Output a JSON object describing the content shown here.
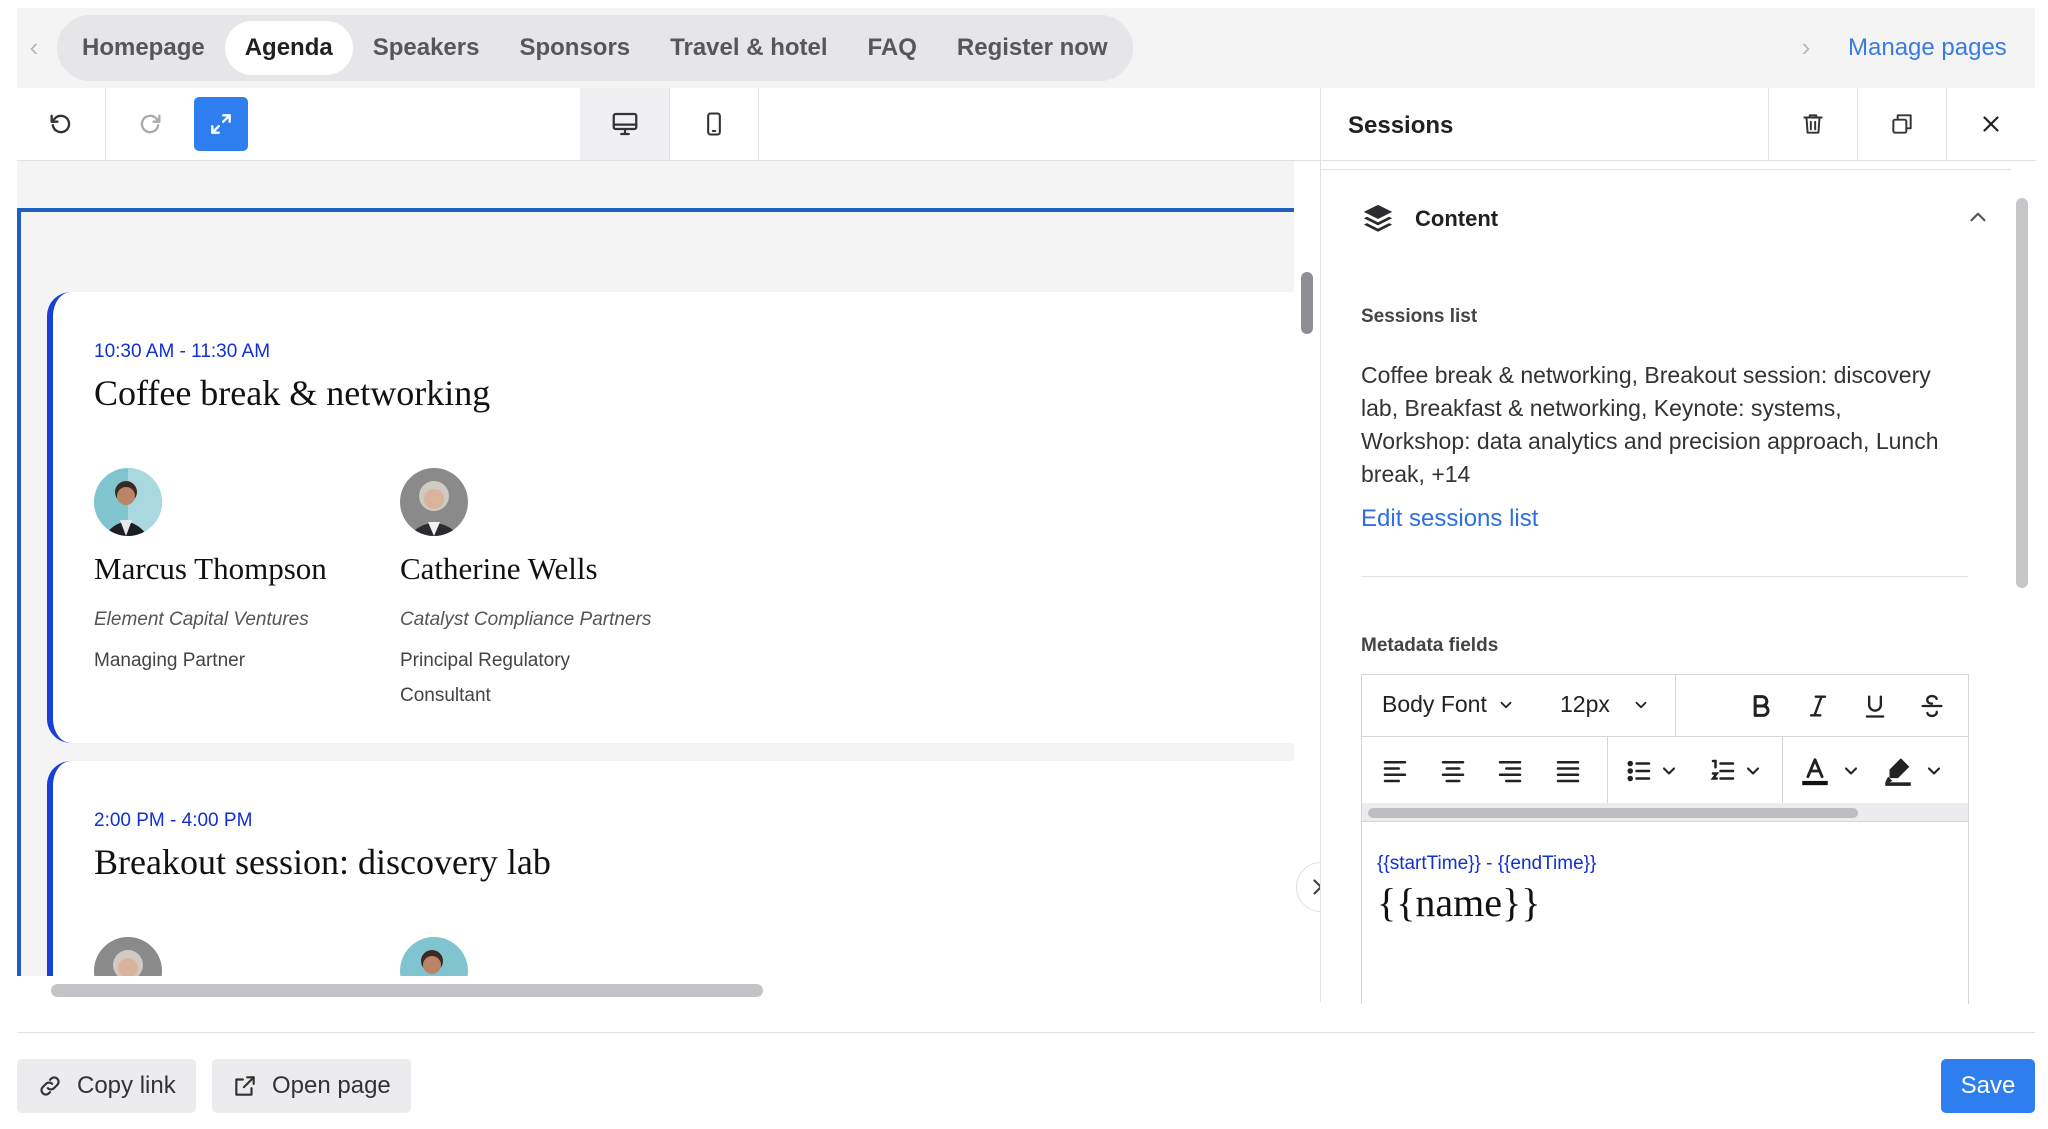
{
  "nav": {
    "pages": [
      {
        "label": "Homepage"
      },
      {
        "label": "Agenda",
        "active": true
      },
      {
        "label": "Speakers"
      },
      {
        "label": "Sponsors"
      },
      {
        "label": "Travel & hotel"
      },
      {
        "label": "FAQ"
      },
      {
        "label": "Register now"
      }
    ],
    "manage_pages": "Manage pages"
  },
  "toolbar": {
    "icons": [
      "undo-icon",
      "redo-icon",
      "expand-icon",
      "desktop-icon",
      "mobile-icon"
    ]
  },
  "preview": {
    "sessions": [
      {
        "time": "10:30 AM - 11:30 AM",
        "title": "Coffee break & networking",
        "speakers": [
          {
            "name": "Marcus Thompson",
            "company": "Element Capital Ventures",
            "role": "Managing Partner"
          },
          {
            "name": "Catherine Wells",
            "company": "Catalyst Compliance Partners",
            "role": "Principal Regulatory Consultant"
          }
        ]
      },
      {
        "time": "2:00 PM - 4:00 PM",
        "title": "Breakout session: discovery lab"
      }
    ]
  },
  "panel": {
    "title": "Sessions",
    "section_title": "Content",
    "sessions_list_label": "Sessions list",
    "sessions_list_value": "Coffee break & networking, Breakout session: discovery lab, Breakfast & networking, Keynote: systems, Workshop: data analytics and precision approach, Lunch break, +14",
    "edit_link": "Edit sessions list",
    "metadata_label": "Metadata fields",
    "editor": {
      "font": "Body Font",
      "size": "12px",
      "meta_line": "{{startTime}} - {{endTime}}",
      "name_line": "{{name}}"
    }
  },
  "footer": {
    "copy_link": "Copy link",
    "open_page": "Open page",
    "save": "Save"
  },
  "colors": {
    "accent": "#2f7ef0",
    "link": "#3a7be0",
    "session_border": "#1740d8",
    "time_text": "#1230d2"
  }
}
